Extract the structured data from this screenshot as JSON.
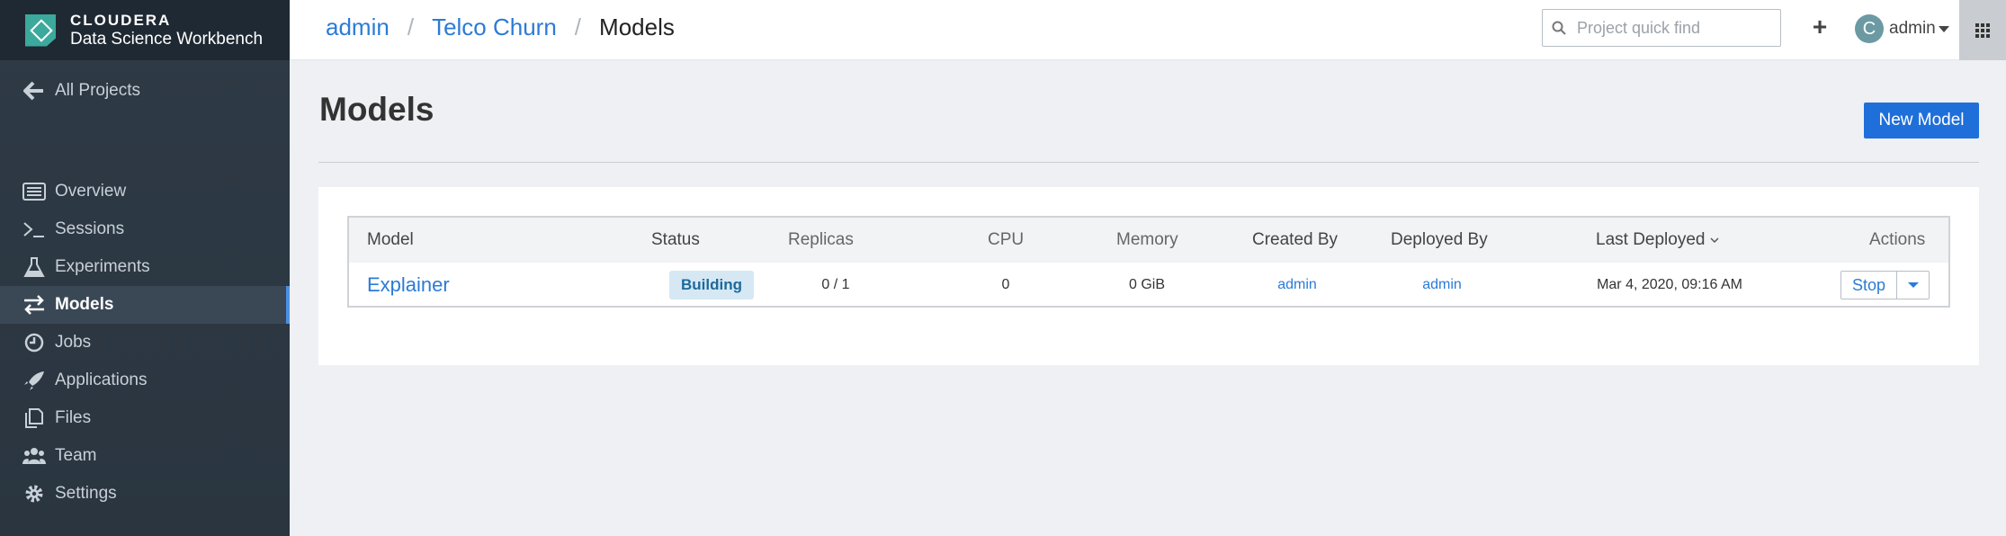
{
  "brand": {
    "company": "CLOUDERA",
    "product": "Data Science Workbench"
  },
  "sidebar": {
    "back_label": "All Projects",
    "items": [
      {
        "label": "Overview",
        "icon": "overview-icon"
      },
      {
        "label": "Sessions",
        "icon": "terminal-icon"
      },
      {
        "label": "Experiments",
        "icon": "flask-icon"
      },
      {
        "label": "Models",
        "icon": "arrows-icon",
        "active": true
      },
      {
        "label": "Jobs",
        "icon": "clock-icon"
      },
      {
        "label": "Applications",
        "icon": "rocket-icon"
      },
      {
        "label": "Files",
        "icon": "files-icon"
      },
      {
        "label": "Team",
        "icon": "team-icon"
      },
      {
        "label": "Settings",
        "icon": "gear-icon"
      }
    ]
  },
  "header": {
    "breadcrumb": [
      "admin",
      "Telco Churn",
      "Models"
    ],
    "separator": "/",
    "search_placeholder": "Project quick find",
    "plus_label": "+",
    "avatar_initial": "C",
    "user_name": "admin"
  },
  "main": {
    "title": "Models",
    "new_model_label": "New Model",
    "table": {
      "columns": [
        "Model",
        "Status",
        "Replicas",
        "CPU",
        "Memory",
        "Created By",
        "Deployed By",
        "Last Deployed",
        "Actions"
      ],
      "rows": [
        {
          "model": "Explainer",
          "status": "Building",
          "replicas": "0 / 1",
          "cpu": "0",
          "memory": "0 GiB",
          "created_by": "admin",
          "deployed_by": "admin",
          "last_deployed": "Mar 4, 2020, 09:16 AM",
          "action": "Stop"
        }
      ]
    }
  },
  "colors": {
    "sidebar_bg": "#2e3a45",
    "accent": "#1f6fdb",
    "link": "#2b7bd6",
    "brand_logo": "#3ba99c",
    "status_building_bg": "#d6e8f4"
  }
}
